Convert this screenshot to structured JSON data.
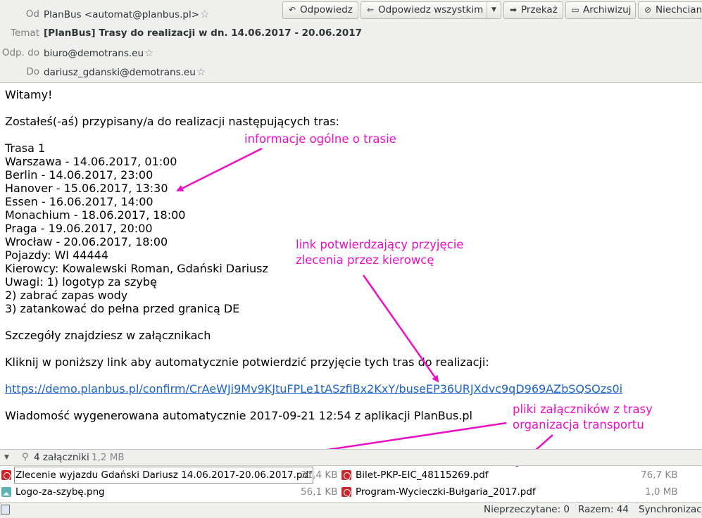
{
  "header": {
    "from_label": "Od",
    "from_value": "PlanBus <automat@planbus.pl>",
    "subject_label": "Temat",
    "subject_value": "[PlanBus] Trasy do realizacji w dn. 14.06.2017 - 20.06.2017",
    "replyto_label": "Odp. do",
    "replyto_value": "biuro@demotrans.eu",
    "to_label": "Do",
    "to_value": "dariusz_gdanski@demotrans.eu"
  },
  "toolbar": {
    "reply": "Odpowiedz",
    "reply_all": "Odpowiedz wszystkim",
    "forward": "Przekaż",
    "archive": "Archiwizuj",
    "junk": "Niechciana"
  },
  "body": {
    "greeting": "Witamy!",
    "intro": "Zostałeś(-aś) przypisany/a do realizacji następujących tras:",
    "route_title": "Trasa 1",
    "route_stops": [
      "Warszawa - 14.06.2017, 01:00",
      "Berlin - 14.06.2017, 23:00",
      "Hanover - 15.06.2017, 13:30",
      "Essen - 16.06.2017, 14:00",
      "Monachium - 18.06.2017, 18:00",
      "Praga - 19.06.2017, 20:00",
      "Wrocław - 20.06.2017, 18:00"
    ],
    "vehicles": "Pojazdy: WI 44444",
    "drivers": "Kierowcy: Kowalewski Roman, Gdański Dariusz",
    "notes": [
      "Uwagi: 1) logotyp za szybę",
      "2) zabrać zapas wody",
      "3) zatankować do pełna przed granicą DE"
    ],
    "details": "Szczegóły znajdziesz w załącznikach",
    "click_info": "Kliknij w poniższy link aby automatycznie potwierdzić przyjęcie tych tras do realizacji:",
    "confirm_link": "https://demo.planbus.pl/confirm/CrAeWJi9Mv9KJtuFPLe1tASzfiBx2KxY/buseEP36URJXdvc9qD969AZbSQSOzs0i",
    "footer": "Wiadomość wygenerowana automatycznie 2017-09-21 12:54 z aplikacji PlanBus.pl"
  },
  "annotations": {
    "route_info": "informacje ogólne o trasie",
    "link_info_1": "link potwierdzający przyjęcie",
    "link_info_2": "zlecenia przez kierowcę",
    "files_info_1": "pliki załączników z trasy",
    "files_info_2": "organizacja transportu",
    "color": "#ec10c6"
  },
  "attachments": {
    "count_label": "4 załączniki",
    "total_size": "1,2 MB",
    "files": [
      {
        "name": "Zlecenie wyjazdu Gdański Dariusz 14.06.2017-20.06.2017.pdf",
        "size": "31,4 KB",
        "icon": "pdf-icon"
      },
      {
        "name": "Bilet-PKP-EIC_48115269.pdf",
        "size": "76,7 KB",
        "icon": "pdf-icon"
      },
      {
        "name": "Logo-za-szybę.png",
        "size": "56,1 KB",
        "icon": "image-icon"
      },
      {
        "name": "Program-Wycieczki-Bułgaria_2017.pdf",
        "size": "1,0 MB",
        "icon": "pdf-icon"
      }
    ]
  },
  "status": {
    "unread": "Nieprzeczytane: 0",
    "total": "Razem: 44",
    "sync": "Synchronizacja"
  }
}
